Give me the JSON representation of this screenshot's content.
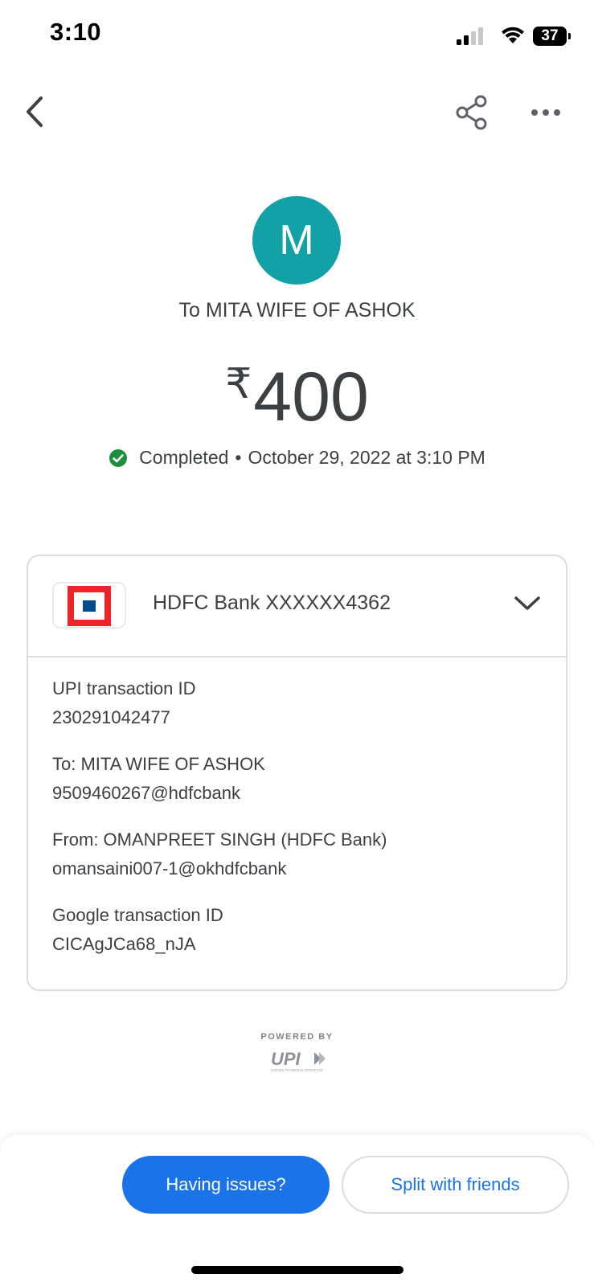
{
  "status_bar": {
    "time": "3:10",
    "battery": "37"
  },
  "toolbar": {
    "icons": [
      "back-icon",
      "share-icon",
      "more-options-icon"
    ]
  },
  "payment": {
    "avatar_initial": "M",
    "avatar_color": "#12a1a7",
    "recipient_line": "To MITA WIFE OF ASHOK",
    "currency_symbol": "₹",
    "amount": "400",
    "status": "Completed",
    "separator": "•",
    "datetime": "October 29, 2022 at 3:10 PM",
    "status_color": "#1e8e3e"
  },
  "card": {
    "bank_name": "HDFC Bank XXXXXX4362",
    "details": [
      {
        "label": "UPI transaction ID",
        "value": "230291042477"
      },
      {
        "label": "To: MITA WIFE OF ASHOK",
        "value": "9509460267@hdfcbank"
      },
      {
        "label": "From: OMANPREET SINGH (HDFC Bank)",
        "value": "omansaini007-1@okhdfcbank"
      },
      {
        "label": "Google transaction ID",
        "value": "CICAgJCa68_nJA"
      }
    ]
  },
  "footer": {
    "powered_by": "POWERED BY",
    "upi_logo_text": "UPI",
    "upi_tagline": "UNIFIED PAYMENTS INTERFACE"
  },
  "actions": {
    "having_issues": "Having issues?",
    "split_with_friends": "Split with friends",
    "accent_color": "#1a73e8"
  }
}
